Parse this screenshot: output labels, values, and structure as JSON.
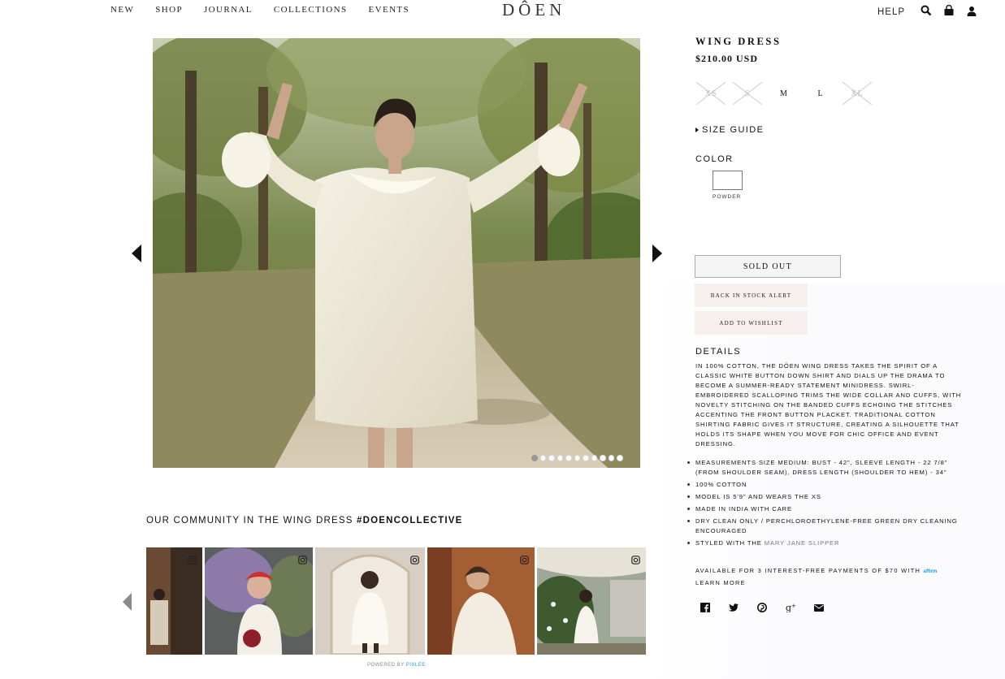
{
  "header": {
    "nav": [
      "NEW",
      "SHOP",
      "JOURNAL",
      "COLLECTIONS",
      "EVENTS"
    ],
    "logo": "DÔEN",
    "help": "HELP",
    "icons": [
      "search-icon",
      "shopping-bag-icon",
      "account-icon"
    ]
  },
  "gallery": {
    "slide_count": 11,
    "active_slide": 0
  },
  "community": {
    "title_prefix": "OUR COMMUNITY IN THE WING DRESS ",
    "hashtag": "#DOENCOLLECTIVE",
    "powered_by": "POWERED BY",
    "powered_brand": "PIXLEE"
  },
  "product": {
    "title": "WING DRESS",
    "price": "$210.00 USD",
    "sizes": [
      {
        "label": "XS",
        "available": false
      },
      {
        "label": "S",
        "available": false
      },
      {
        "label": "M",
        "available": true
      },
      {
        "label": "L",
        "available": true
      },
      {
        "label": "XL",
        "available": false
      }
    ],
    "size_guide": "SIZE GUIDE",
    "color_label": "COLOR",
    "color_name": "POWDER",
    "sold_out": "SOLD OUT",
    "back_in_stock": "BACK IN STOCK ALERT",
    "wishlist": "ADD TO WISHLIST",
    "details_heading": "DETAILS",
    "details_text": "IN 100% COTTON, THE DÔEN WING DRESS TAKES THE SPIRIT OF A CLASSIC WHITE BUTTON DOWN SHIRT AND DIALS UP THE DRAMA TO BECOME A SUMMER-READY STATEMENT MINIDRESS. SWIRL-EMBROIDERED SCALLOPING TRIMS THE WIDE COLLAR AND CUFFS, WITH NOVELTY STITCHING ON THE BANDED CUFFS ECHOING THE STITCHES ACCENTING THE FRONT BUTTON PLACKET. TRADITIONAL COTTON SHIRTING FABRIC GIVES IT STRUCTURE, CREATING A SILHOUETTE THAT HOLDS ITS SHAPE WHEN YOU MOVE FOR CHIC OFFICE AND EVENT DRESSING.",
    "bullets": [
      "MEASUREMENTS SIZE MEDIUM: BUST - 42\", SLEEVE LENGTH - 22 7/8\" (FROM SHOULDER SEAM), DRESS LENGTH (SHOULDER TO HEM) - 34\"",
      "100% COTTON",
      "MODEL IS 5'9\" AND WEARS THE XS",
      "MADE IN INDIA WITH CARE",
      "DRY CLEAN ONLY / PERCHLOROETHYLENE-FREE GREEN DRY CLEANING ENCOURAGED"
    ],
    "styled_with_prefix": "STYLED WITH THE ",
    "styled_with_link": "MARY JANE SLIPPER",
    "affirm_text": "AVAILABLE FOR 3 INTEREST-FREE PAYMENTS OF $70 WITH ",
    "affirm_brand": "affirm",
    "learn_more": "LEARN MORE",
    "social_icons": [
      "facebook-icon",
      "twitter-icon",
      "pinterest-icon",
      "google-plus-icon",
      "email-icon"
    ]
  },
  "colors": {
    "text": "#111111",
    "pink_button": "#f7eeee",
    "link_gray": "#777777"
  }
}
